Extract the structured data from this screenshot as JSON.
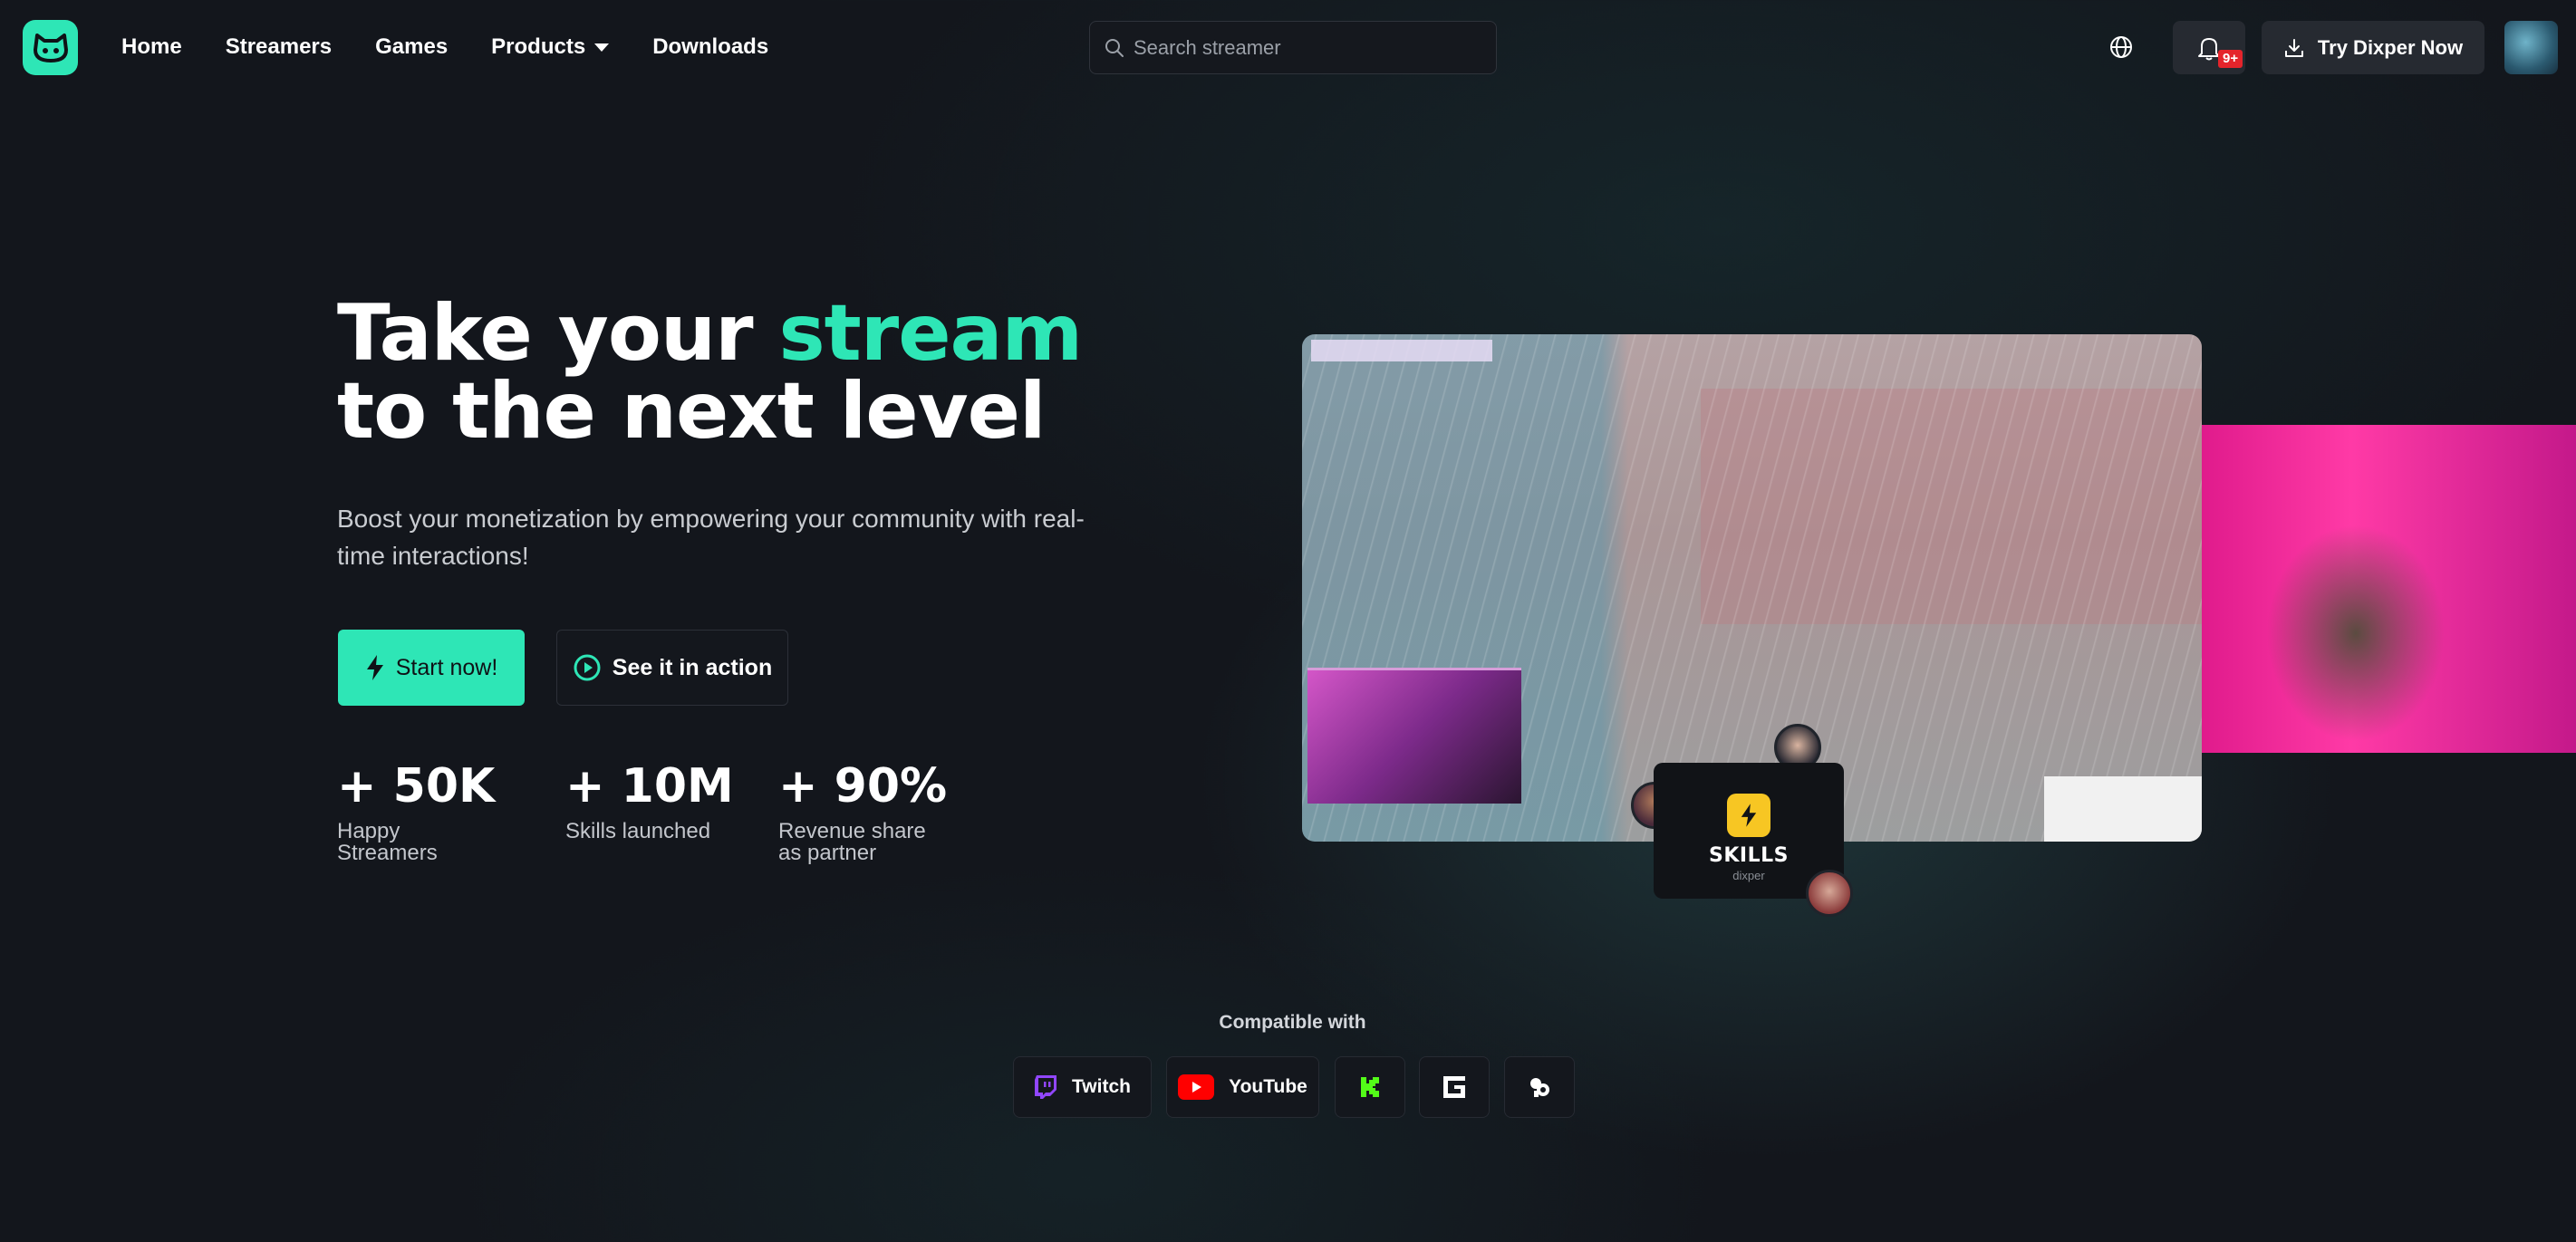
{
  "nav": {
    "links": [
      "Home",
      "Streamers",
      "Games",
      "Products",
      "Downloads"
    ],
    "search_placeholder": "Search streamer",
    "notifications_badge": "9+",
    "cta": "Try Dixper Now"
  },
  "hero": {
    "headline_part1": "Take your ",
    "headline_accent": "stream",
    "headline_part2": "to the next level",
    "subtitle": "Boost your monetization by empowering your community with real-time interactions!",
    "start_button": "Start now!",
    "see_button": "See it in action",
    "stats": [
      {
        "value": "+ 50K",
        "label_line1": "Happy",
        "label_line2": "Streamers"
      },
      {
        "value": "+ 10M",
        "label_line1": "Skills launched",
        "label_line2": ""
      },
      {
        "value": "+ 90%",
        "label_line1": "Revenue share",
        "label_line2": "as partner"
      }
    ]
  },
  "media": {
    "skills_title": "SKILLS",
    "skills_sub": "dixper"
  },
  "compatible": {
    "title": "Compatible with",
    "platforms": [
      {
        "name": "Twitch",
        "icon": "twitch-icon"
      },
      {
        "name": "YouTube",
        "icon": "youtube-icon"
      },
      {
        "name": "",
        "icon": "kick-icon"
      },
      {
        "name": "",
        "icon": "facebook-gaming-icon"
      },
      {
        "name": "",
        "icon": "tiktok-icon"
      }
    ]
  },
  "colors": {
    "accent": "#2ee6b6",
    "background": "#13161c",
    "badge": "#e5242b"
  }
}
